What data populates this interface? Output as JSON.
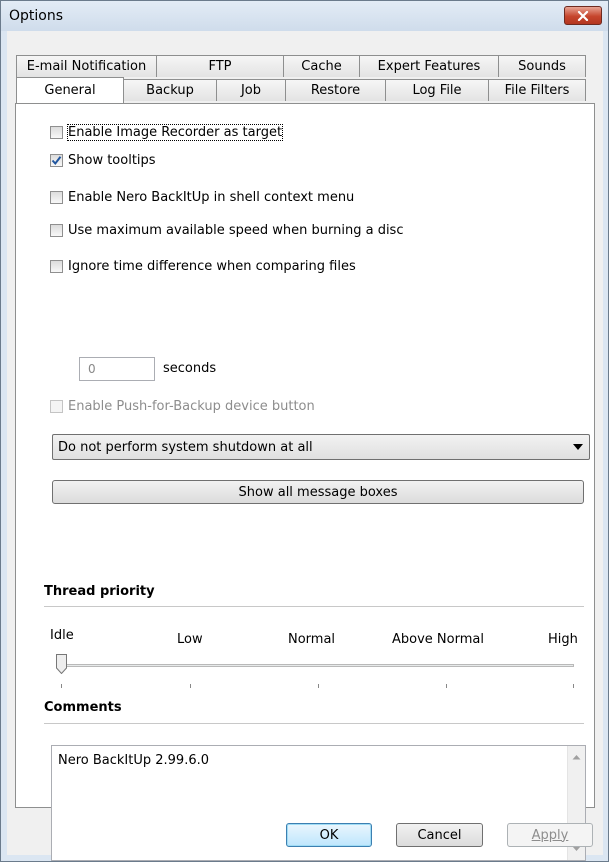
{
  "window": {
    "title": "Options"
  },
  "tabs": {
    "row1": [
      "E-mail Notification",
      "FTP",
      "Cache",
      "Expert Features",
      "Sounds"
    ],
    "row2": [
      "General",
      "Backup",
      "Job",
      "Restore",
      "Log File",
      "File Filters"
    ],
    "active": "General"
  },
  "general": {
    "options": [
      {
        "label": "Enable Image Recorder as target",
        "checked": false
      },
      {
        "label": "Show tooltips",
        "checked": true
      },
      {
        "label": "Enable Nero BackItUp in shell context menu",
        "checked": false
      },
      {
        "label": "Use maximum available speed when burning a disc",
        "checked": false
      },
      {
        "label": "Ignore time difference when comparing files",
        "checked": false
      }
    ],
    "time_diff_value": "0",
    "time_diff_unit": "seconds",
    "push_backup": {
      "label": "Enable Push-for-Backup device button",
      "checked": false,
      "enabled": false
    },
    "shutdown_select": "Do not perform system shutdown at all",
    "show_messages_button": "Show all message boxes"
  },
  "thread_priority": {
    "heading": "Thread priority",
    "levels": [
      "Idle",
      "Low",
      "Normal",
      "Above Normal",
      "High"
    ],
    "selected": "Idle"
  },
  "comments": {
    "heading": "Comments",
    "text": "Nero BackItUp 2.99.6.0"
  },
  "buttons": {
    "ok": "OK",
    "cancel": "Cancel",
    "apply": "Apply"
  },
  "colors": {
    "close_button": "#c6452d",
    "frame": "#dbe6f2",
    "check": "#21569f"
  }
}
